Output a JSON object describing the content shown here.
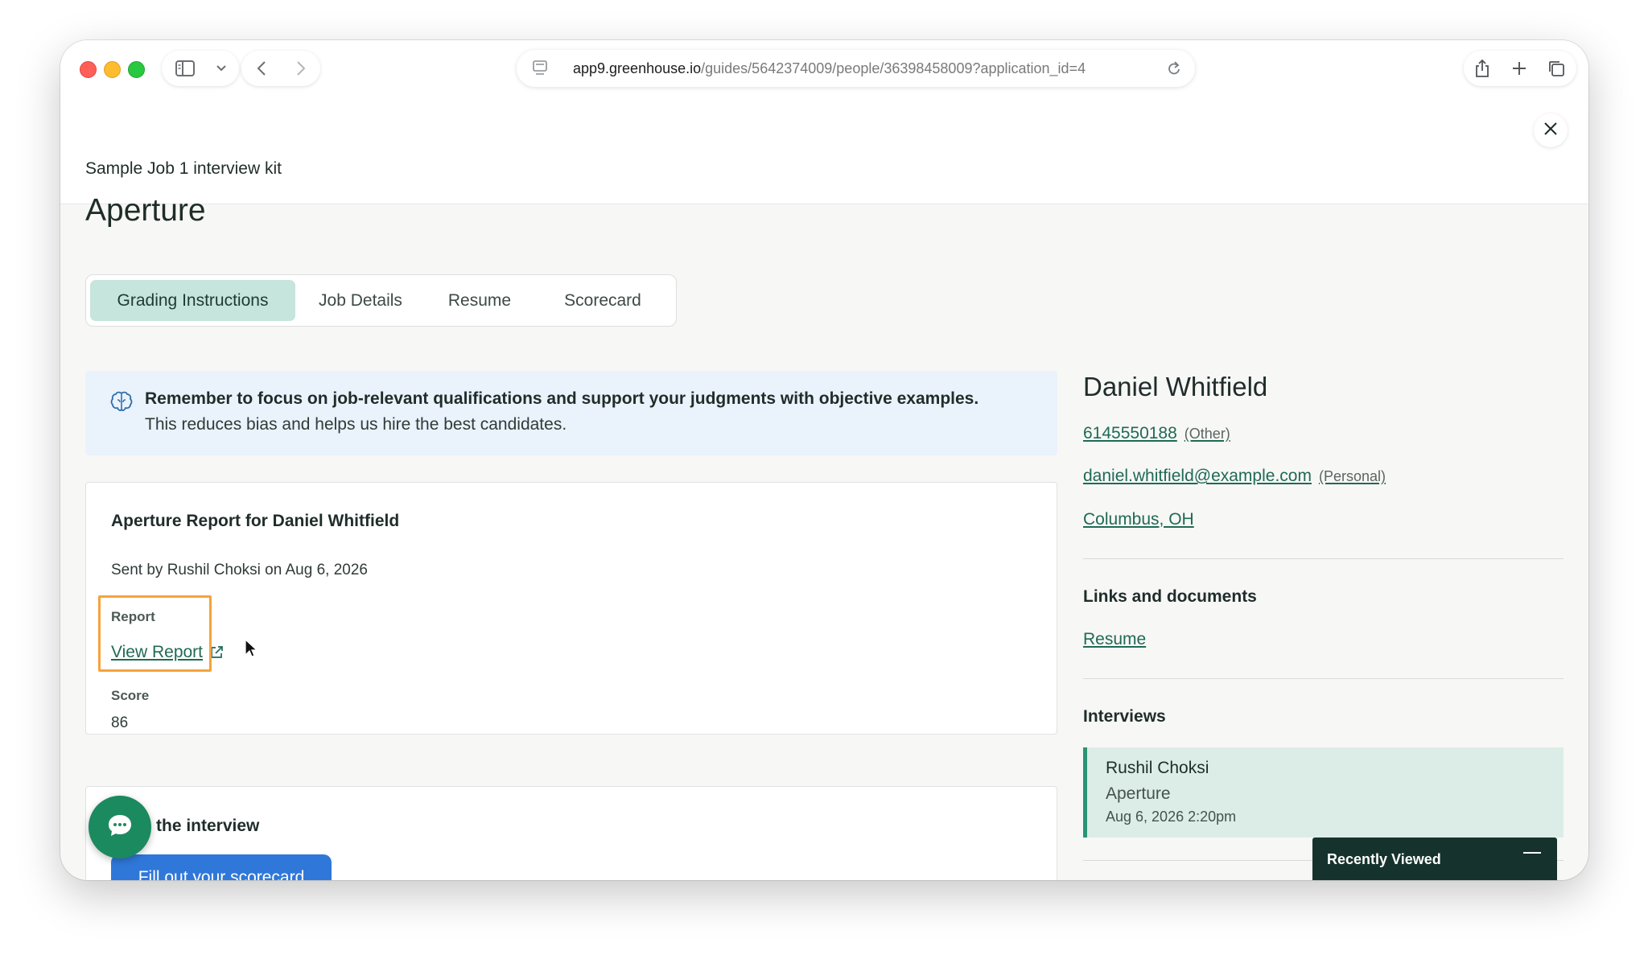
{
  "browser": {
    "url_host": "app9.greenhouse.io",
    "url_path": "/guides/5642374009/people/36398458009?application_id=4"
  },
  "header": {
    "kit_title": "Sample Job 1 interview kit",
    "page_title": "Aperture"
  },
  "tabs": [
    {
      "label": "Grading Instructions",
      "active": true
    },
    {
      "label": "Job Details",
      "active": false
    },
    {
      "label": "Resume",
      "active": false
    },
    {
      "label": "Scorecard",
      "active": false
    }
  ],
  "banner": {
    "bold": "Remember to focus on job-relevant qualifications and support your judgments with objective examples.",
    "sub": "This reduces bias and helps us hire the best candidates."
  },
  "report_card": {
    "title": "Aperture Report for Daniel Whitfield",
    "sent_by": "Sent by Rushil Choksi on Aug 6, 2026",
    "report_label": "Report",
    "view_report": "View Report",
    "score_label": "Score",
    "score_value": "86"
  },
  "interview_card": {
    "title_partial": "the interview",
    "button_label": "Fill out your scorecard"
  },
  "candidate": {
    "name": "Daniel Whitfield",
    "phone": "6145550188",
    "phone_type": "(Other)",
    "email": "daniel.whitfield@example.com",
    "email_type": "(Personal)",
    "location": "Columbus, OH"
  },
  "links_section": {
    "heading": "Links and documents",
    "resume_link": "Resume"
  },
  "interviews_section": {
    "heading": "Interviews",
    "items": [
      {
        "interviewer": "Rushil Choksi",
        "job": "Aperture",
        "datetime": "Aug 6, 2026 2:20pm"
      }
    ]
  },
  "recently_viewed": {
    "label": "Recently Viewed"
  },
  "colors": {
    "accent_green": "#1f6a54",
    "tab_active_bg": "#c6e5dc",
    "highlight_orange": "#f5a33b",
    "primary_button": "#2f78d9",
    "chat_button": "#1c8a5f"
  }
}
